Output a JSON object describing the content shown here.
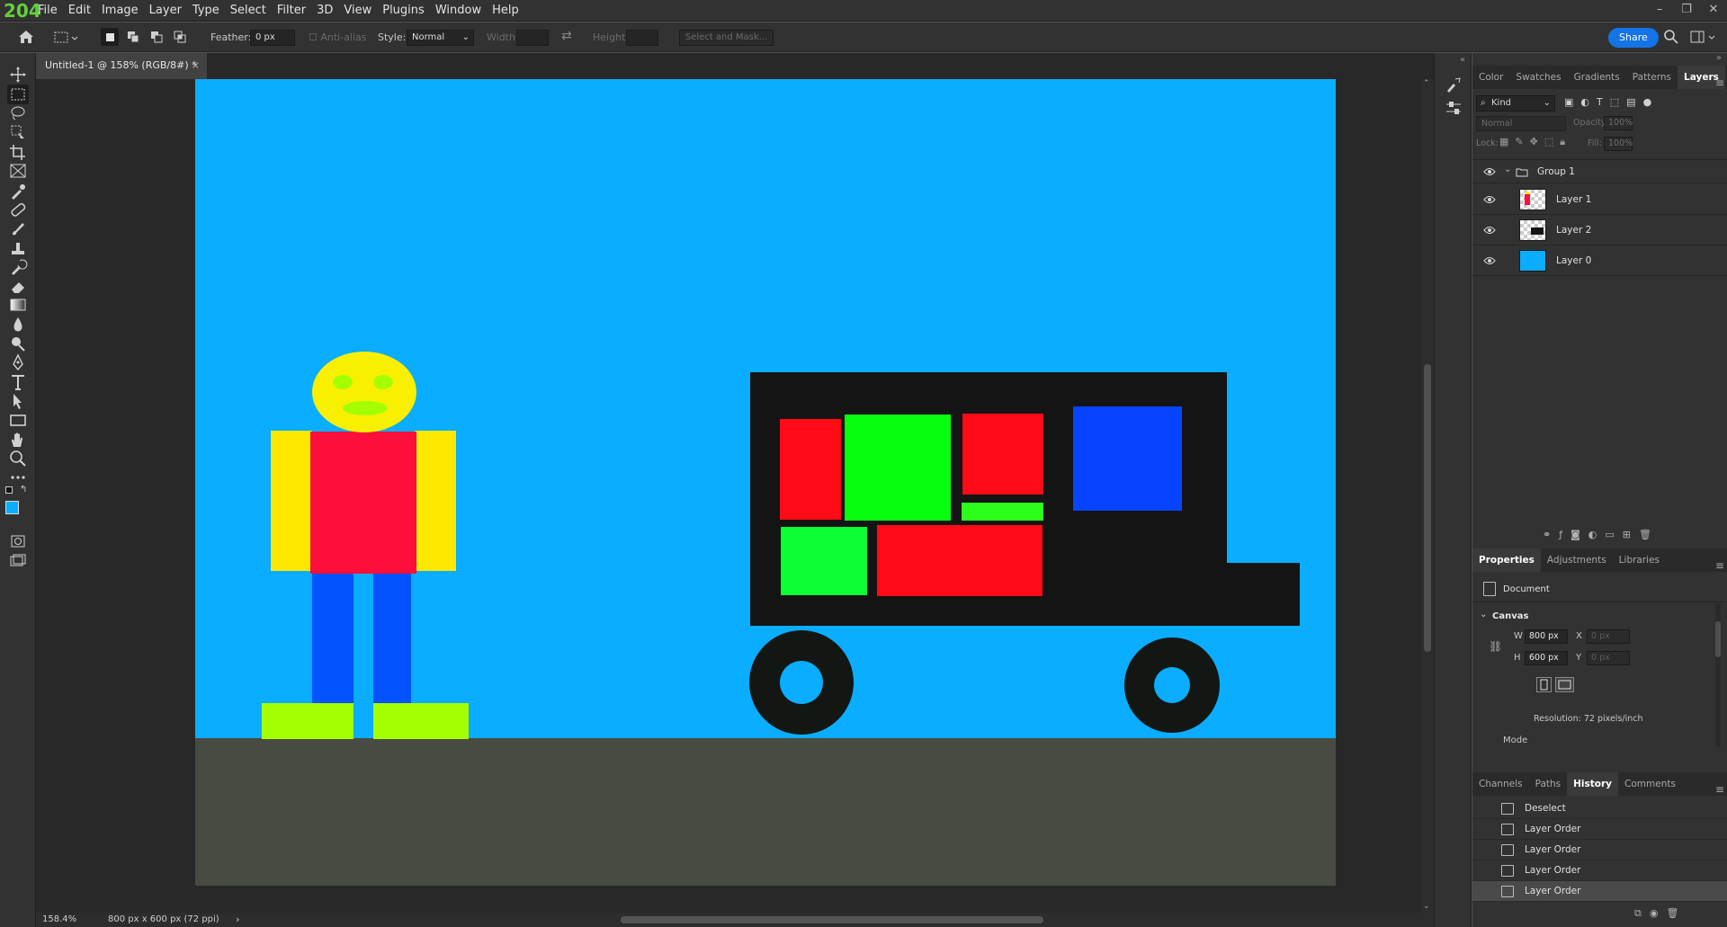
{
  "app": {
    "logo_text": "204"
  },
  "menu": [
    "File",
    "Edit",
    "Image",
    "Layer",
    "Type",
    "Select",
    "Filter",
    "3D",
    "View",
    "Plugins",
    "Window",
    "Help"
  ],
  "window_controls": {
    "minimize": "–",
    "restore": "❐",
    "close": "✕"
  },
  "options": {
    "feather_label": "Feather:",
    "feather_value": "0 px",
    "antialias_label": "Anti-alias",
    "style_label": "Style:",
    "style_value": "Normal",
    "width_label": "Width:",
    "height_label": "Height:",
    "select_mask_label": "Select and Mask...",
    "share_label": "Share"
  },
  "document_tab": {
    "title": "Untitled-1 @ 158% (RGB/8#) *",
    "close": "×"
  },
  "status": {
    "zoom": "158.4%",
    "doc_info": "800 px x 600 px (72 ppi)",
    "arrow": "›"
  },
  "colors": {
    "sky": "#0aadff",
    "ground": "#474b41",
    "accent": "#1473e6",
    "foreground_swatch": "#0aadff",
    "background_swatch": "#ffffff",
    "head": "#f8f000",
    "arm": "#ffe800",
    "torso": "#fc0f3a",
    "leg": "#0453ff",
    "foot": "#a4ff00",
    "mouth": "#a4ff00",
    "truck_body": "#141414",
    "cargo_red": "#ff0b17",
    "cargo_green": "#06ff0c",
    "cargo_green2": "#0cff34",
    "cargo_blue": "#0844ff",
    "wheel": "#131713"
  },
  "panels_top": {
    "tabs": [
      "Color",
      "Swatches",
      "Gradients",
      "Patterns",
      "Layers"
    ],
    "active_tab": "Layers",
    "filter_kind": "Kind",
    "blend_mode": "Normal",
    "opacity_label": "Opacity:",
    "opacity_value": "100%",
    "lock_label": "Lock:",
    "fill_label": "Fill:",
    "fill_value": "100%",
    "layers": [
      {
        "name": "Group 1",
        "type": "group"
      },
      {
        "name": "Layer 1",
        "type": "layer"
      },
      {
        "name": "Layer 2",
        "type": "layer"
      },
      {
        "name": "Layer 0",
        "type": "layer"
      }
    ]
  },
  "properties": {
    "tabs": [
      "Properties",
      "Adjustments",
      "Libraries"
    ],
    "active_tab": "Properties",
    "document_label": "Document",
    "section_label": "Canvas",
    "w_label": "W",
    "w_value": "800 px",
    "h_label": "H",
    "h_value": "600 px",
    "x_label": "X",
    "x_placeholder": "0 px",
    "y_label": "Y",
    "y_placeholder": "0 px",
    "resolution": "Resolution: 72 pixels/inch",
    "mode_label": "Mode"
  },
  "history": {
    "tabs": [
      "Channels",
      "Paths",
      "History",
      "Comments"
    ],
    "active_tab": "History",
    "items": [
      "Deselect",
      "Layer Order",
      "Layer Order",
      "Layer Order",
      "Layer Order"
    ]
  },
  "tools": [
    "move-tool",
    "marquee-tool",
    "lasso-tool",
    "object-select-tool",
    "crop-tool",
    "frame-tool",
    "eyedropper-tool",
    "healing-tool",
    "brush-tool",
    "stamp-tool",
    "history-brush-tool",
    "eraser-tool",
    "gradient-tool",
    "blur-tool",
    "dodge-tool",
    "pen-tool",
    "type-tool",
    "path-select-tool",
    "rectangle-tool",
    "hand-tool",
    "zoom-tool",
    "more-tools"
  ]
}
